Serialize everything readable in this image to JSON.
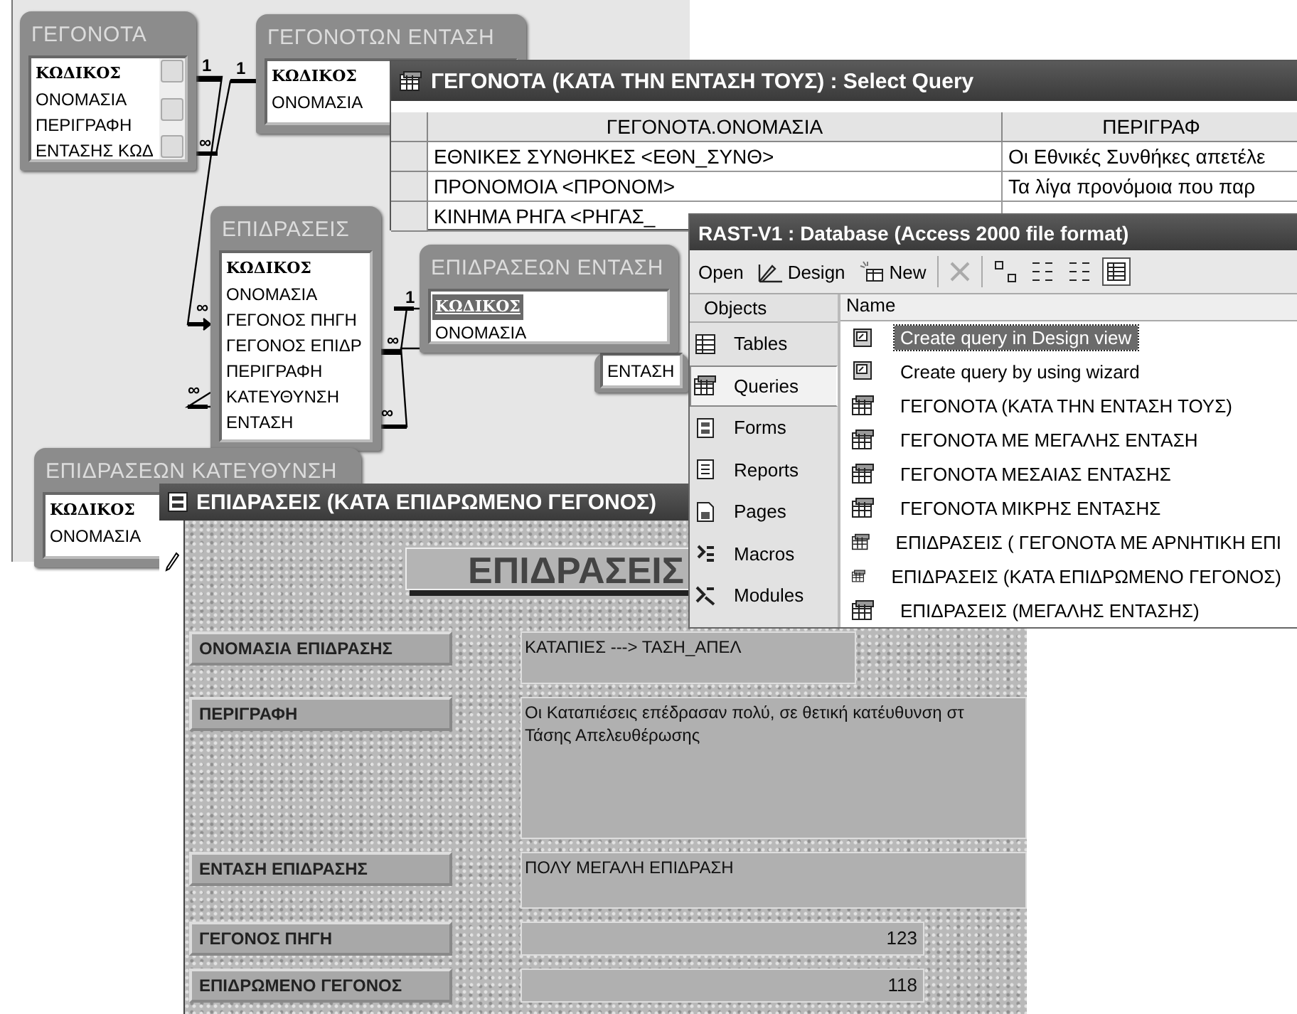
{
  "diagram": {
    "tables": [
      {
        "title": "ΓΕΓΟΝΟΤΑ",
        "scrollbar": true,
        "fields": [
          {
            "name": "ΚΩΔΙΚΟΣ",
            "key": true,
            "selected": false
          },
          {
            "name": "ΟΝΟΜΑΣΙΑ",
            "key": false,
            "selected": false
          },
          {
            "name": "ΠΕΡΙΓΡΑΦΗ",
            "key": false,
            "selected": false
          },
          {
            "name": "ΕΝΤΑΣΗΣ ΚΩΔ",
            "key": false,
            "selected": false
          }
        ]
      },
      {
        "title": "ΓΕΓΟΝΟΤΩΝ ΕΝΤΑΣΗ",
        "scrollbar": false,
        "fields": [
          {
            "name": "ΚΩΔΙΚΟΣ",
            "key": true,
            "selected": false
          },
          {
            "name": "ΟΝΟΜΑΣΙΑ",
            "key": false,
            "selected": false
          }
        ]
      },
      {
        "title": "ΕΠΙΔΡΑΣΕΙΣ",
        "scrollbar": false,
        "fields": [
          {
            "name": "ΚΩΔΙΚΟΣ",
            "key": true,
            "selected": false
          },
          {
            "name": "ΟΝΟΜΑΣΙΑ",
            "key": false,
            "selected": false
          },
          {
            "name": "ΓΕΓΟΝΟΣ ΠΗΓΗ",
            "key": false,
            "selected": false
          },
          {
            "name": "ΓΕΓΟΝΟΣ ΕΠΙΔΡ",
            "key": false,
            "selected": false
          },
          {
            "name": "ΠΕΡΙΓΡΑΦΗ",
            "key": false,
            "selected": false
          },
          {
            "name": "ΚΑΤΕΥΘΥΝΣΗ",
            "key": false,
            "selected": false
          },
          {
            "name": "ΕΝΤΑΣΗ",
            "key": false,
            "selected": false
          }
        ]
      },
      {
        "scrollbar": false,
        "fields": [
          {
            "name": "ΕΝΤΑΣΗ",
            "key": false,
            "selected": false
          }
        ]
      },
      {
        "title": "ΕΠΙΔΡΑΣΕΩΝ ΕΝΤΑΣΗ",
        "scrollbar": false,
        "fields": [
          {
            "name": "ΚΩΔΙΚΟΣ",
            "key": true,
            "selected": true
          },
          {
            "name": "ΟΝΟΜΑΣΙΑ",
            "key": false,
            "selected": false
          }
        ]
      },
      {
        "title": "ΕΠΙΔΡΑΣΕΩΝ ΚΑΤΕΥΘΥΝΣΗ",
        "scrollbar": false,
        "fields": [
          {
            "name": "ΚΩΔΙΚΟΣ",
            "key": true,
            "selected": false
          },
          {
            "name": "ΟΝΟΜΑΣΙΑ",
            "key": false,
            "selected": false
          }
        ]
      }
    ],
    "join_marks": [
      "1",
      "1",
      "∞",
      "∞",
      "∞",
      "1",
      "∞",
      "∞"
    ]
  },
  "query_window": {
    "title": "ΓΕΓΟΝΟΤΑ (ΚΑΤΑ ΤΗΝ ΕΝΤΑΣΗ ΤΟΥΣ) : Select Query",
    "columns": [
      "ΓΕΓΟΝΟΤΑ.ΟΝΟΜΑΣΙΑ",
      "ΠΕΡΙΓΡΑΦ"
    ],
    "rows": [
      [
        "ΕΘΝΙΚΕΣ ΣΥΝΘΗΚΕΣ <ΕΘΝ_ΣΥΝΘ>",
        "Οι Εθνικές Συνθήκες απετέλε"
      ],
      [
        "ΠΡΟΝΟΜΟΙΑ <ΠΡΟΝΟΜ>",
        "Τα λίγα προνόμοια που παρ"
      ],
      [
        "ΚΙΝΗΜΑ ΡΗΓΑ <ΡΗΓΑΣ_"
      ]
    ]
  },
  "database_window": {
    "title": "RAST-V1 : Database (Access 2000 file format)",
    "toolbar": [
      {
        "kind": "open",
        "label": "Open"
      },
      {
        "kind": "design",
        "label": "Design"
      },
      {
        "kind": "new",
        "label": "New"
      }
    ],
    "views": [
      {
        "selected": false
      },
      {
        "selected": false
      },
      {
        "selected": false
      },
      {
        "selected": true
      }
    ],
    "objects_header": "Objects",
    "objects": [
      {
        "kind": "table",
        "label": "Tables",
        "selected": false
      },
      {
        "kind": "query",
        "label": "Queries",
        "selected": true
      },
      {
        "kind": "form",
        "label": "Forms",
        "selected": false
      },
      {
        "kind": "report",
        "label": "Reports",
        "selected": false
      },
      {
        "kind": "page",
        "label": "Pages",
        "selected": false
      },
      {
        "kind": "macro",
        "label": "Macros",
        "selected": false
      },
      {
        "kind": "module",
        "label": "Modules",
        "selected": false
      }
    ],
    "list_header": "Name",
    "items": [
      {
        "kind": "shortcut",
        "label": "Create query in Design view",
        "selected": true
      },
      {
        "kind": "shortcut",
        "label": "Create query by using wizard",
        "selected": false
      },
      {
        "kind": "query",
        "label": "ΓΕΓΟΝΟΤΑ (ΚΑΤΑ ΤΗΝ ΕΝΤΑΣΗ ΤΟΥΣ)",
        "selected": false
      },
      {
        "kind": "query",
        "label": "ΓΕΓΟΝΟΤΑ ΜΕ ΜΕΓΑΛΗΣ ΕΝΤΑΣΗ",
        "selected": false
      },
      {
        "kind": "query",
        "label": "ΓΕΓΟΝΟΤΑ ΜΕΣΑΙΑΣ ΕΝΤΑΣΗΣ",
        "selected": false
      },
      {
        "kind": "query",
        "label": "ΓΕΓΟΝΟΤΑ ΜΙΚΡΗΣ ΕΝΤΑΣΗΣ",
        "selected": false
      },
      {
        "kind": "query",
        "label": "ΕΠΙΔΡΑΣΕΙΣ ( ΓΕΓΟΝΟΤΑ ΜΕ ΑΡΝΗΤΙΚΗ ΕΠΙ",
        "selected": false
      },
      {
        "kind": "query",
        "label": "ΕΠΙΔΡΑΣΕΙΣ (ΚΑΤΑ ΕΠΙΔΡΩΜΕΝΟ ΓΕΓΟΝΟΣ)",
        "selected": false
      },
      {
        "kind": "query",
        "label": "ΕΠΙΔΡΑΣΕΙΣ (ΜΕΓΑΛΗΣ ΕΝΤΑΣΗΣ)",
        "selected": false
      }
    ]
  },
  "form_window": {
    "title": "ΕΠΙΔΡΑΣΕΙΣ (ΚΑΤΑ ΕΠΙΔΡΩΜΕΝΟ ΓΕΓΟΝΟΣ)",
    "heading": "ΕΠΙΔΡΑΣΕΙΣ",
    "fields": [
      {
        "kind": "short",
        "label": "ΟΝΟΜΑΣΙΑ ΕΠΙΔΡΑΣΗΣ",
        "lines": [
          "ΚΑΤΑΠΙΕΣ ---> ΤΑΣΗ_ΑΠΕΛ"
        ]
      },
      {
        "kind": "memo",
        "label": "ΠΕΡΙΓΡΑΦΗ",
        "lines": [
          "Οι Καταπιέσεις επέδρασαν πολύ, σε θετική κατέυθυνση στ",
          "Τάσης Απελευθέρωσης"
        ]
      },
      {
        "kind": "long",
        "label": "ΕΝΤΑΣΗ ΕΠΙΔΡΑΣΗΣ",
        "lines": [
          "ΠΟΛΥ ΜΕΓΑΛΗ ΕΠΙΔΡΑΣΗ"
        ]
      },
      {
        "kind": "number",
        "label": "ΓΕΓΟΝΟΣ ΠΗΓΗ",
        "lines": [
          "123"
        ]
      },
      {
        "kind": "number",
        "label": "ΕΠΙΔΡΩΜΕΝΟ ΓΕΓΟΝΟΣ",
        "lines": [
          "118"
        ]
      }
    ]
  }
}
